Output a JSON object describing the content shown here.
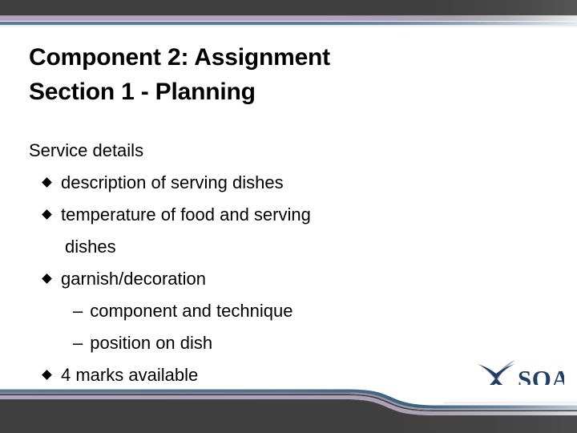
{
  "slide": {
    "title_lines": [
      "Component 2: Assignment",
      "Section 1 - Planning"
    ],
    "body": [
      {
        "level": 0,
        "bullet": "none",
        "text": "Service details"
      },
      {
        "level": 1,
        "bullet": "diamond",
        "text": "description of serving dishes"
      },
      {
        "level": 1,
        "bullet": "diamond",
        "text": "temperature of food and serving"
      },
      {
        "level": 1,
        "bullet": "none",
        "text": "dishes"
      },
      {
        "level": 1,
        "bullet": "diamond",
        "text": "garnish/decoration"
      },
      {
        "level": 2,
        "bullet": "dash",
        "text": "component and technique"
      },
      {
        "level": 2,
        "bullet": "dash",
        "text": "position on dish"
      },
      {
        "level": 1,
        "bullet": "diamond",
        "text": "4 marks available"
      }
    ],
    "bullet_glyphs": {
      "diamond": "◆",
      "dash": "–"
    }
  },
  "logo": {
    "name": "SQA",
    "wordmark": "SQA",
    "colors": {
      "navy": "#1f3f68",
      "navy_dark": "#16314f",
      "lilac": "#9b8fc0",
      "lilac_light": "#b8aed4"
    }
  },
  "theme": {
    "background": "#ffffff",
    "band_dark": "#3f3f3f",
    "band_purple": "#b3a3c0",
    "band_blue": "#5a7a96",
    "text": "#000000"
  }
}
